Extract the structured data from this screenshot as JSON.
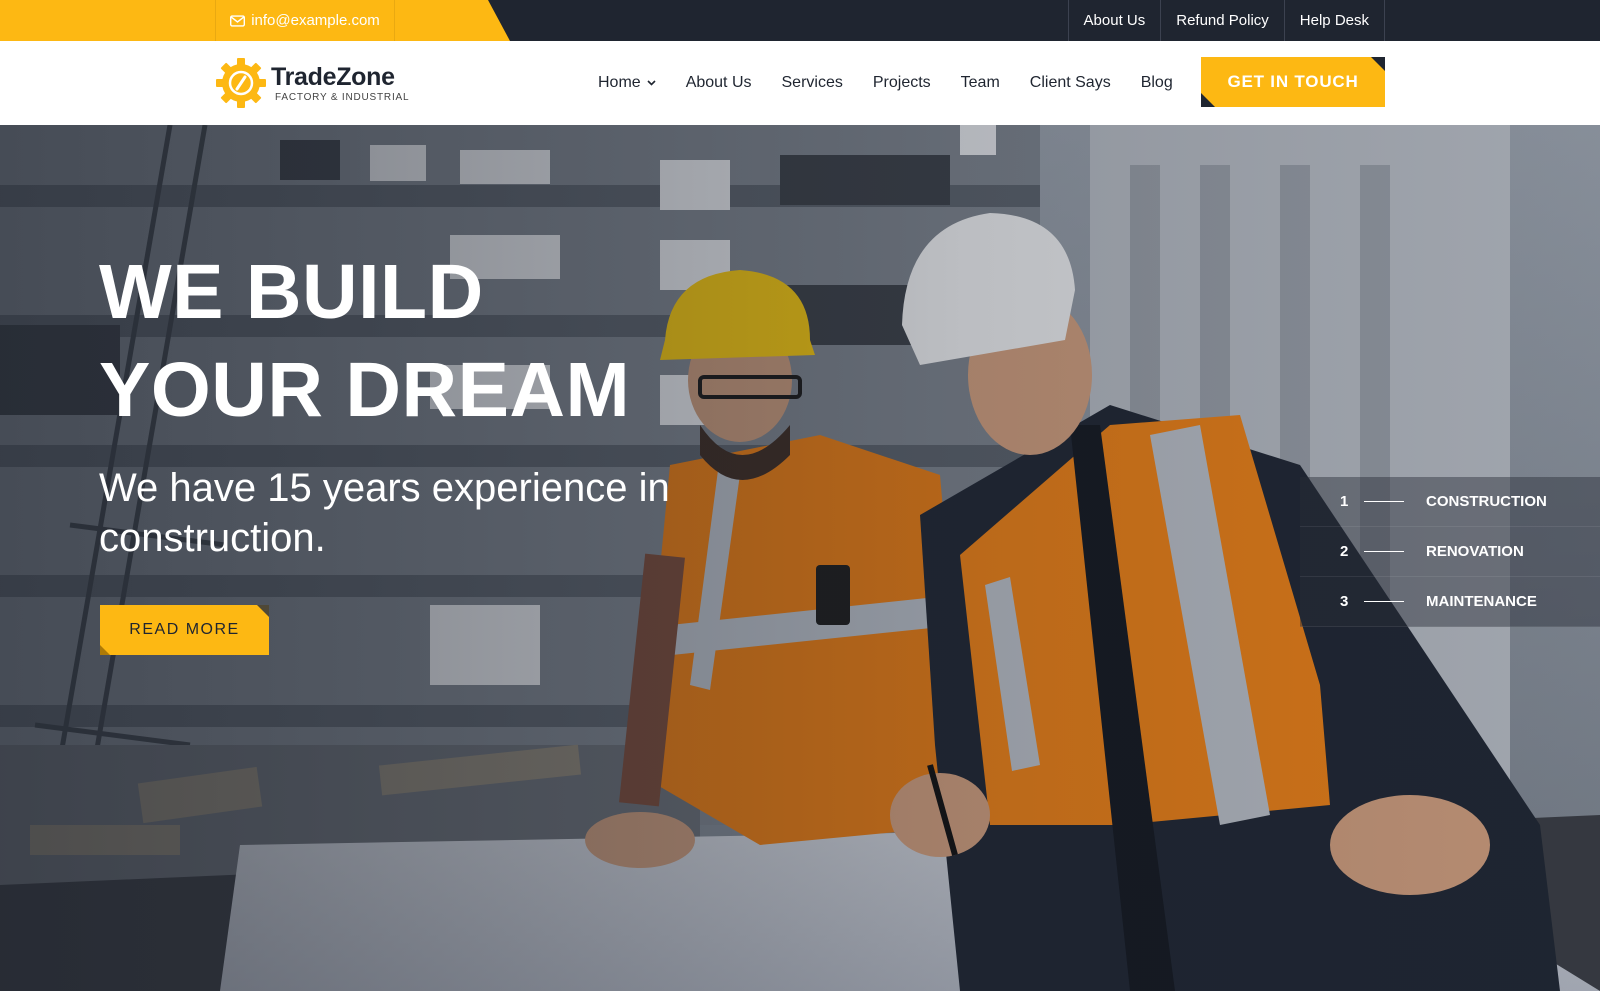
{
  "topbar": {
    "email": "info@example.com",
    "links": [
      "About Us",
      "Refund Policy",
      "Help Desk"
    ]
  },
  "header": {
    "logo": {
      "name": "TradeZone",
      "tagline": "FACTORY & INDUSTRIAL"
    },
    "nav": [
      "Home",
      "About Us",
      "Services",
      "Projects",
      "Team",
      "Client Says",
      "Blog"
    ],
    "cta": "GET IN TOUCH"
  },
  "hero": {
    "title_line1": "WE BUILD",
    "title_line2": "YOUR DREAM",
    "subtitle": "We have 15 years experience in construction.",
    "button": "READ MORE",
    "slides": [
      {
        "num": "1",
        "label": "CONSTRUCTION"
      },
      {
        "num": "2",
        "label": "RENOVATION"
      },
      {
        "num": "3",
        "label": "MAINTENANCE"
      }
    ]
  },
  "colors": {
    "accent": "#fdb813",
    "dark": "#1f2530"
  }
}
